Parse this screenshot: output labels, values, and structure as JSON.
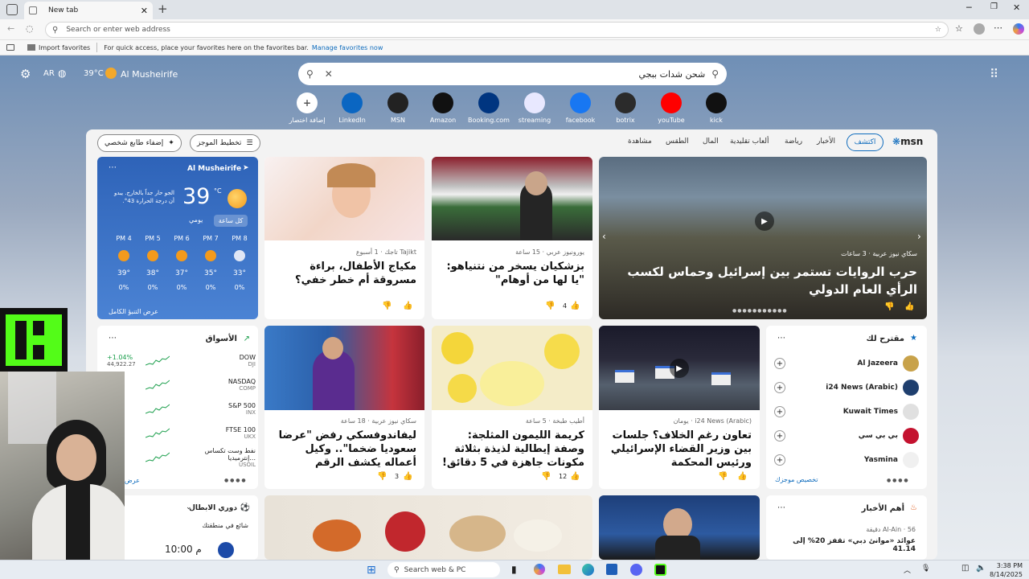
{
  "browser": {
    "tab_title": "New tab",
    "address_placeholder": "Search or enter web address",
    "favorites_import": "Import favorites",
    "favorites_hint": "For quick access, place your favorites here on the favorites bar.",
    "favorites_manage": "Manage favorites now"
  },
  "header": {
    "lang": "AR",
    "temp": "39°C",
    "location": "Al Musheirife"
  },
  "search": {
    "value": "شحن شدات ببجي"
  },
  "quicklinks": [
    {
      "label": "إضافة اختصار",
      "icon": "plus-icon",
      "color": "#ffffff"
    },
    {
      "label": "LinkedIn",
      "icon": "linkedin-icon",
      "color": "#0a66c2"
    },
    {
      "label": "MSN",
      "icon": "msn-icon",
      "color": "#222222"
    },
    {
      "label": "Amazon",
      "icon": "amazon-icon",
      "color": "#111111"
    },
    {
      "label": "Booking.com",
      "icon": "booking-icon",
      "color": "#003580"
    },
    {
      "label": "streaming",
      "icon": "streaming-icon",
      "color": "#e8e8ff"
    },
    {
      "label": "facebook",
      "icon": "facebook-icon",
      "color": "#1877f2"
    },
    {
      "label": "botrix",
      "icon": "botrix-icon",
      "color": "#2b2b2b"
    },
    {
      "label": "youTube",
      "icon": "youtube-icon",
      "color": "#ff0000"
    },
    {
      "label": "kick",
      "icon": "kick-icon",
      "color": "#111111"
    }
  ],
  "feed_nav": {
    "brand": "msn",
    "tabs": [
      "اكتشف",
      "الأخبار",
      "رياضة",
      "ألعاب تقليدية",
      "المال",
      "الطقس",
      "مشاهدة"
    ],
    "layout_btn": "تخطيط الموجز",
    "personalize_btn": "إضفاء طابع شخصي"
  },
  "weather": {
    "location": "Al Musheirife",
    "temp": "39",
    "unit": "°C",
    "desc": "الجو حار جداً بالخارج. يبدو أن درجة الحرارة 43°.",
    "tab_hourly": "كل ساعة",
    "tab_daily": "يومي",
    "hours": [
      {
        "time": "PM 8",
        "temp": "33°",
        "rain": "0%"
      },
      {
        "time": "PM 7",
        "temp": "35°",
        "rain": "0%"
      },
      {
        "time": "PM 6",
        "temp": "37°",
        "rain": "0%"
      },
      {
        "time": "PM 5",
        "temp": "38°",
        "rain": "0%"
      },
      {
        "time": "PM 4",
        "temp": "39°",
        "rain": "0%"
      }
    ],
    "forecast_link": "عرض التنبؤ الكامل"
  },
  "articles": {
    "a1": {
      "source": "Tajikt تاجك",
      "time": "1 أسبوع",
      "title": "مكياج الأطفال، براءة مسروقة أم خطر خفي؟"
    },
    "a2": {
      "source": "يورونيوز عربي",
      "time": "15 ساعة",
      "title": "بزشكيان يسخر من نتنياهو: \"يا لها من أوهام\"",
      "likes": "4"
    },
    "a3": {
      "source": "سكاي نيوز عربية",
      "time": "3 ساعات",
      "title": "حرب الروايات تستمر بين إسرائيل وحماس لكسب الرأي العام الدولي"
    },
    "a4": {
      "source": "سكاي نيوز عربية",
      "time": "18 ساعة",
      "title": "ليفاندوفسكي رفض \"عرضا سعوديا ضخما\".. وكيل أعماله يكشف الرقم",
      "likes": "3"
    },
    "a5": {
      "source": "أطيب طبخة",
      "time": "5 ساعة",
      "title": "كريمة الليمون المثلجة: وصفة إيطالية لذيذة بثلاثة مكونات جاهزة في 5 دقائق!",
      "likes": "12"
    },
    "a6": {
      "source": "i24 News (Arabic)",
      "time": "يومان",
      "title": "تعاون رغم الخلاف؟ جلسات بين وزير القضاء الإسرائيلي ورئيس المحكمة"
    }
  },
  "markets": {
    "title": "الأسواق",
    "rows": [
      {
        "name": "DOW",
        "sub": "DJI",
        "change": "+1.04%",
        "value": "44,922.27"
      },
      {
        "name": "NASDAQ",
        "sub": "COMP",
        "change": "",
        "value": ""
      },
      {
        "name": "S&P 500",
        "sub": "INX",
        "change": "",
        "value": ""
      },
      {
        "name": "FTSE 100",
        "sub": "UKX",
        "change": "",
        "value": ""
      },
      {
        "name": "نفط وست تكساس إنترميديا...",
        "sub": "USOIL",
        "change": "",
        "value": ""
      }
    ],
    "link": "عرض"
  },
  "suggested": {
    "title": "مقترح لك",
    "rows": [
      {
        "name": "Al Jazeera",
        "color": "#c8a24a"
      },
      {
        "name": "i24 News (Arabic)",
        "color": "#1f3f6e"
      },
      {
        "name": "Kuwait Times",
        "color": "#e0e0e0"
      },
      {
        "name": "بي بي سي",
        "color": "#c4122f"
      },
      {
        "name": "Yasmina",
        "color": "#f0f0f0"
      }
    ],
    "link": "تخصيص موجزك"
  },
  "league": {
    "title": "دوري الابطال",
    "sub": "شائع في منطقتك",
    "time": "10:00 م"
  },
  "topnews": {
    "title": "أهم الأخبار",
    "source": "Al-Ain",
    "time": "56 دقيقة",
    "text": "عوائد «موانئ دبي» تقفز 20% إلى 41.14"
  },
  "taskbar": {
    "search": "Search web & PC",
    "time": "3:38 PM",
    "date": "8/14/2025"
  },
  "colors": {
    "accent": "#0f6cbd",
    "kick_green": "#53fc18"
  }
}
